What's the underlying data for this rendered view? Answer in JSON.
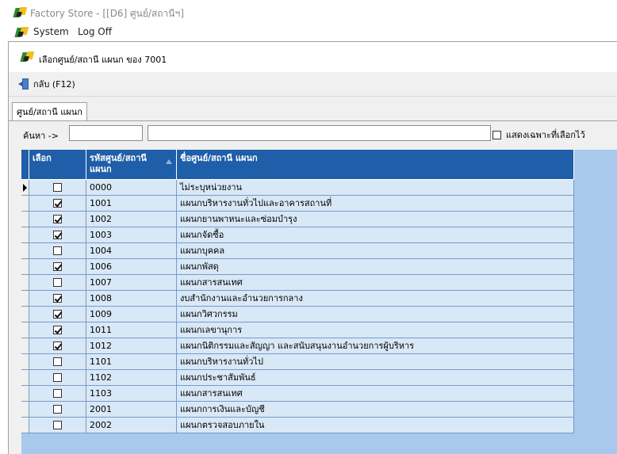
{
  "window": {
    "title": "Factory Store - [[D6] ศูนย์/สถานีฯ]"
  },
  "menu": {
    "items": [
      "System",
      "Log Off"
    ]
  },
  "dialog": {
    "title": "เลือกศูนย์/สถานี แผนก ของ 7001"
  },
  "toolbar": {
    "back_label": "กลับ (F12)"
  },
  "tab": {
    "label": "ศูนย์/สถานี แผนก"
  },
  "search": {
    "label": "ค้นหา ->",
    "value": "",
    "value2": "",
    "show_selected_label": "แสดงเฉพาะที่เลือกไว้",
    "show_selected_checked": false
  },
  "grid": {
    "columns": [
      "เลือก",
      "รหัสศูนย์/สถานี แผนก",
      "ชื่อศูนย์/สถานี แผนก"
    ],
    "rows": [
      {
        "checked": false,
        "code": "0000",
        "name": "ไม่ระบุหน่วยงาน"
      },
      {
        "checked": true,
        "code": "1001",
        "name": "แผนกบริหารงานทั่วไปและอาคารสถานที่"
      },
      {
        "checked": true,
        "code": "1002",
        "name": "แผนกยานพาหนะและซ่อมบำรุง"
      },
      {
        "checked": true,
        "code": "1003",
        "name": "แผนกจัดซื้อ"
      },
      {
        "checked": false,
        "code": "1004",
        "name": "แผนกบุคคล"
      },
      {
        "checked": true,
        "code": "1006",
        "name": "แผนกพัสดุ"
      },
      {
        "checked": false,
        "code": "1007",
        "name": "แผนกสารสนเทศ"
      },
      {
        "checked": true,
        "code": "1008",
        "name": "งบสำนักงานและอำนวยการกลาง"
      },
      {
        "checked": true,
        "code": "1009",
        "name": "แผนกวิศวกรรม"
      },
      {
        "checked": true,
        "code": "1011",
        "name": "แผนกเลขานุการ"
      },
      {
        "checked": true,
        "code": "1012",
        "name": "แผนกนิติกรรมและสัญญา และสนับสนุนงานอำนวยการผู้บริหาร"
      },
      {
        "checked": false,
        "code": "1101",
        "name": "แผนกบริหารงานทั่วไป"
      },
      {
        "checked": false,
        "code": "1102",
        "name": "แผนกประชาสัมพันธ์"
      },
      {
        "checked": false,
        "code": "1103",
        "name": "แผนกสารสนเทศ"
      },
      {
        "checked": false,
        "code": "2001",
        "name": "แผนกการเงินและบัญชี"
      },
      {
        "checked": false,
        "code": "2002",
        "name": "แผนกตรวจสอบภายใน"
      }
    ]
  }
}
